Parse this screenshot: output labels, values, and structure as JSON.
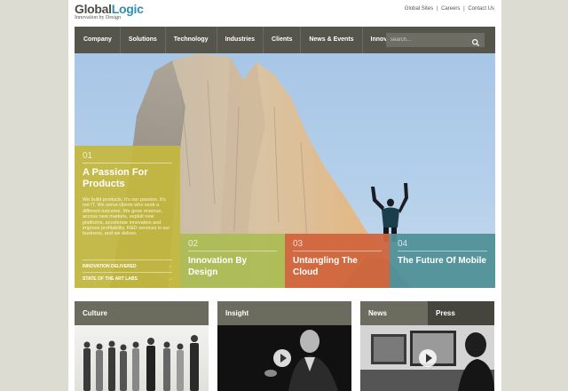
{
  "logo": {
    "part1": "Global",
    "part2": "Logic",
    "tagline": "Innovation by Design"
  },
  "toplinks": [
    "Global Sites",
    "|",
    "Careers",
    "|",
    "Contact Us"
  ],
  "nav": {
    "items": [
      "Company",
      "Solutions",
      "Technology",
      "Industries",
      "Clients",
      "News & Events",
      "Innovate!"
    ],
    "search_placeholder": "search..."
  },
  "hero": {
    "panel1": {
      "num": "01",
      "title": "A Passion For Products",
      "body": "We build products. It's our passion. It's not IT. We serve clients who seek a different outcome. We grow revenue, access new markets, exploit new platforms, accelerate innovation and improve profitability. R&D services is our business, and we deliver.",
      "link1": "INNOVATION DELIVERED",
      "link2": "STATE OF THE ART LABS",
      "arrow": "→"
    },
    "tiles": [
      {
        "num": "02",
        "title": "Innovation By Design"
      },
      {
        "num": "03",
        "title": "Untangling The Cloud"
      },
      {
        "num": "04",
        "title": "The Future Of Mobile"
      }
    ]
  },
  "cards": {
    "culture": "Culture",
    "insight": "Insight",
    "news": "News",
    "press": "Press"
  },
  "colors": {
    "nav_bg": "#55554b",
    "panel1": "#c4b83e",
    "tile2": "#abbc54",
    "tile3": "#d0653d",
    "tile4": "#509198",
    "logo_accent": "#2f8fb3"
  }
}
